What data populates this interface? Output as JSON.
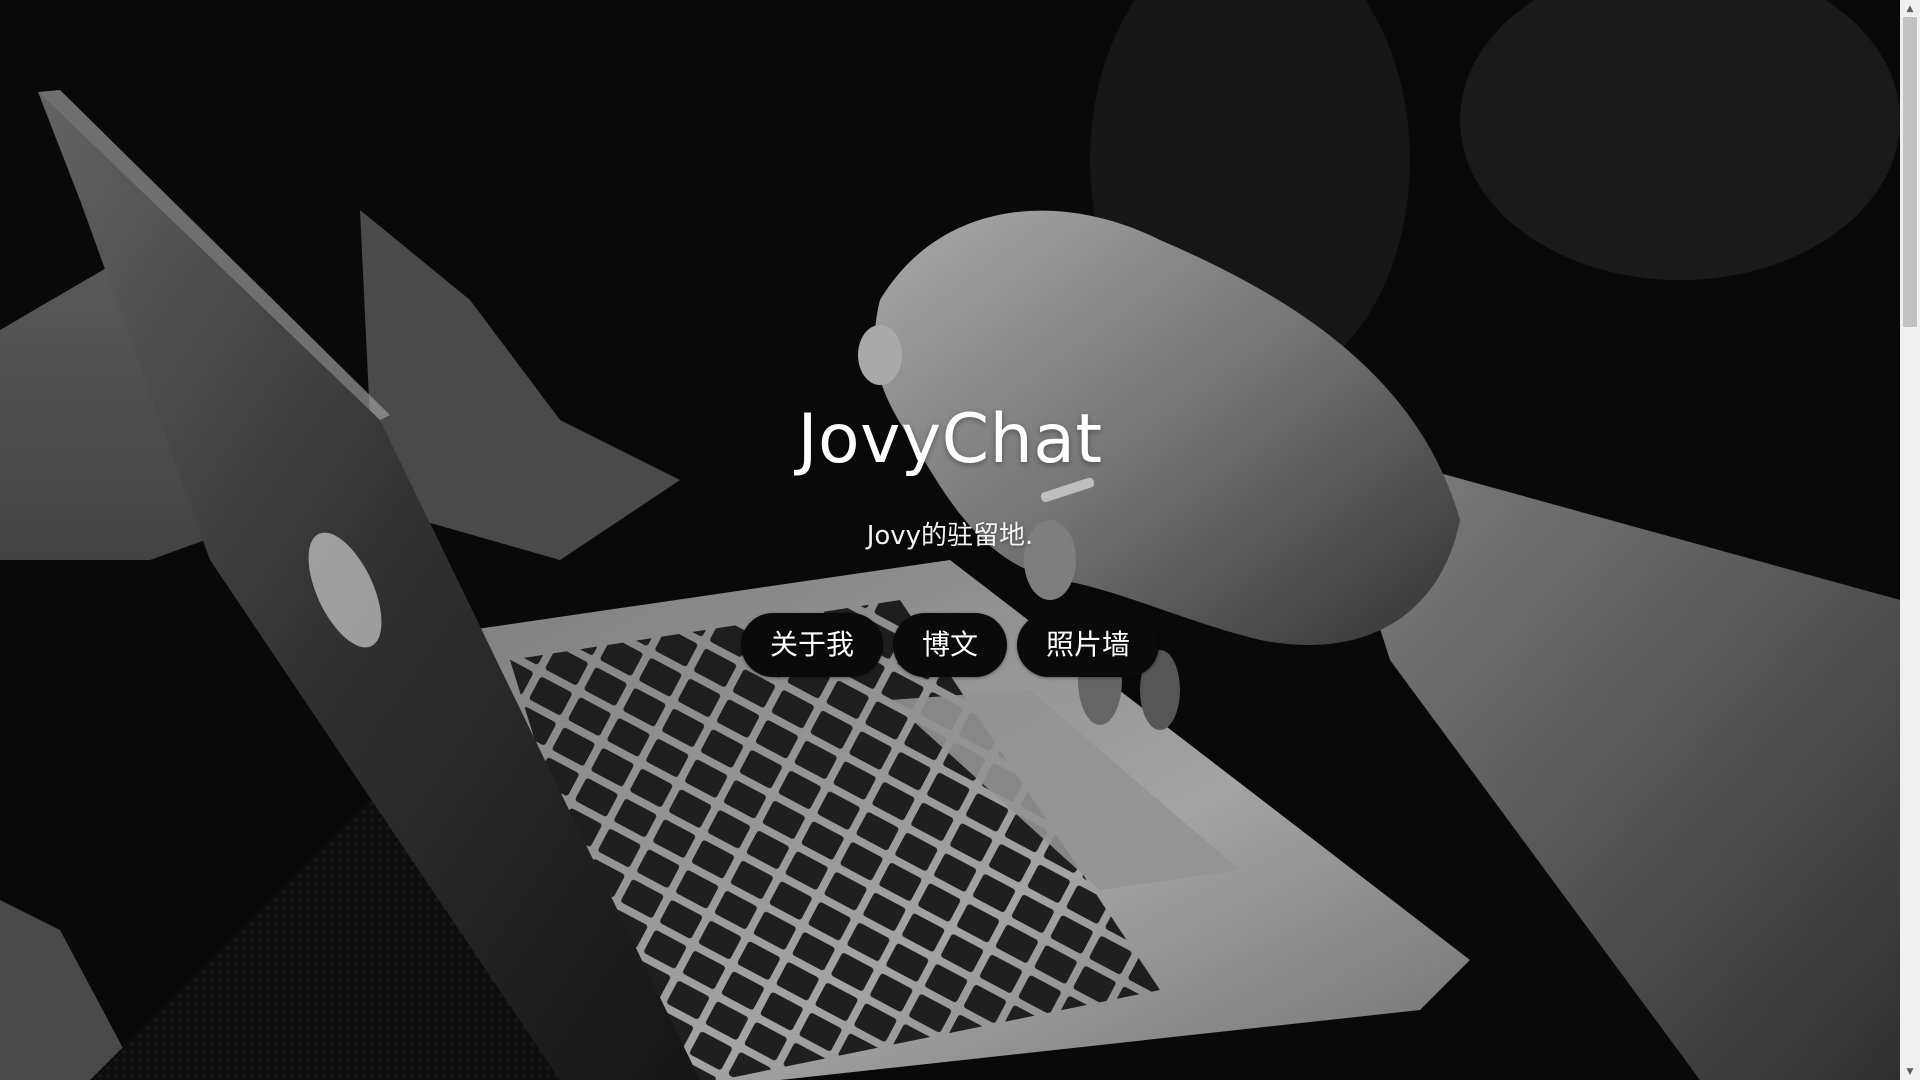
{
  "hero": {
    "title": "JovyChat",
    "subtitle": "Jovy的驻留地.",
    "buttons": [
      {
        "label": "关于我"
      },
      {
        "label": "博文"
      },
      {
        "label": "照片墙"
      }
    ]
  },
  "scrollbar": {
    "up_arrow_icon": "triangle-up-icon",
    "down_arrow_icon": "triangle-down-icon"
  },
  "background": {
    "description_icon": "laptop-photo",
    "colors": {
      "dark": "#0b0b0b",
      "mid": "#4a4a4a",
      "light": "#cfcfcf"
    }
  }
}
